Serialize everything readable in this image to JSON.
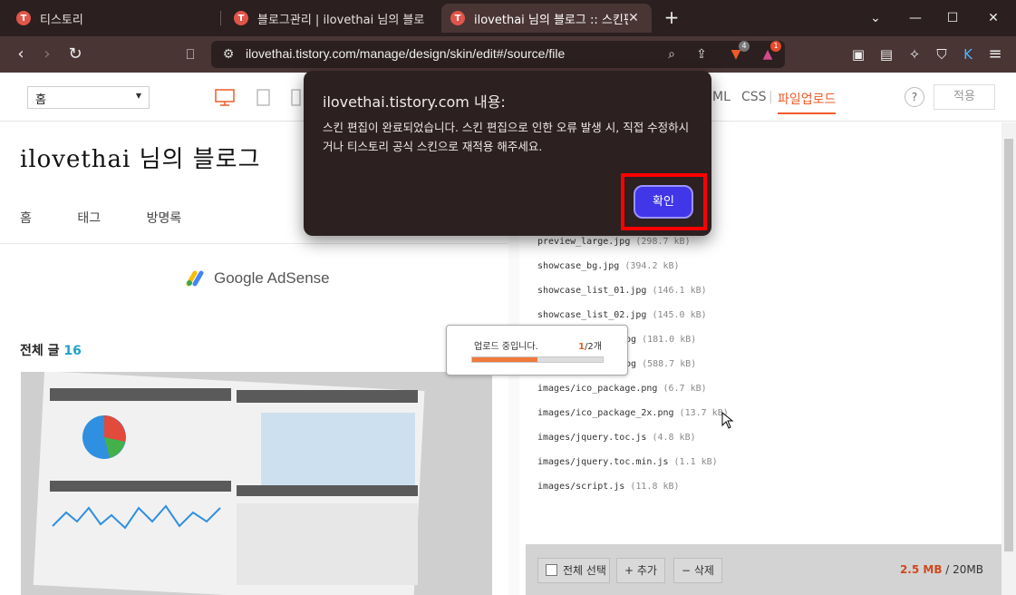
{
  "browser": {
    "tabs": [
      {
        "title": "티스토리",
        "active": false
      },
      {
        "title": "블로그관리 | ilovethai 님의 블로그",
        "active": false
      },
      {
        "title": "ilovethai 님의 블로그 :: 스킨편",
        "active": true
      }
    ],
    "url": "ilovethai.tistory.com/manage/design/skin/edit#/source/file",
    "brave_badge": "4",
    "alert_badge": "1"
  },
  "toolbar": {
    "page_select": "홈",
    "tab_html_partial": "ML",
    "tab_css": "CSS",
    "tab_upload": "파일업로드",
    "help": "?",
    "apply": "적용"
  },
  "preview": {
    "blog_title": "ilovethai 님의 블로그",
    "nav": [
      "홈",
      "태그",
      "방명록"
    ],
    "adsense": "Google AdSense",
    "total_label": "전체 글",
    "total_count": "16"
  },
  "files": [
    {
      "name": "preview_large.jpg",
      "size": "(298.7 kB)"
    },
    {
      "name": "showcase_bg.jpg",
      "size": "(394.2 kB)"
    },
    {
      "name": "showcase_list_01.jpg",
      "size": "(146.1 kB)"
    },
    {
      "name": "showcase_list_02.jpg",
      "size": "(145.0 kB)"
    },
    {
      "name": "pg",
      "size": "(181.0 kB)"
    },
    {
      "name": "pg",
      "size": "(588.7 kB)"
    },
    {
      "name": "images/ico_package.png",
      "size": "(6.7 kB)"
    },
    {
      "name": "images/ico_package_2x.png",
      "size": "(13.7 kB)"
    },
    {
      "name": "images/jquery.toc.js",
      "size": "(4.8 kB)"
    },
    {
      "name": "images/jquery.toc.min.js",
      "size": "(1.1 kB)"
    },
    {
      "name": "images/script.js",
      "size": "(11.8 kB)"
    }
  ],
  "footer": {
    "select_all": "전체 선택",
    "add": "+ 추가",
    "delete": "− 삭제",
    "used": "2.5 MB",
    "limit": " / 20MB"
  },
  "upload": {
    "label": "업로드 중입니다.",
    "current": "1",
    "total": "/2개",
    "progress": 0.5
  },
  "dialog": {
    "title": "ilovethai.tistory.com 내용:",
    "message": "스킨 편집이 완료되었습니다. 스킨 편집으로 인한 오류 발생 시, 직접 수정하시거나 티스토리 공식 스킨으로 재적용 해주세요.",
    "ok": "확인"
  },
  "colors": {
    "accent": "#f05a28",
    "dialog_button": "#4136e8",
    "highlight": "#ff0000"
  }
}
